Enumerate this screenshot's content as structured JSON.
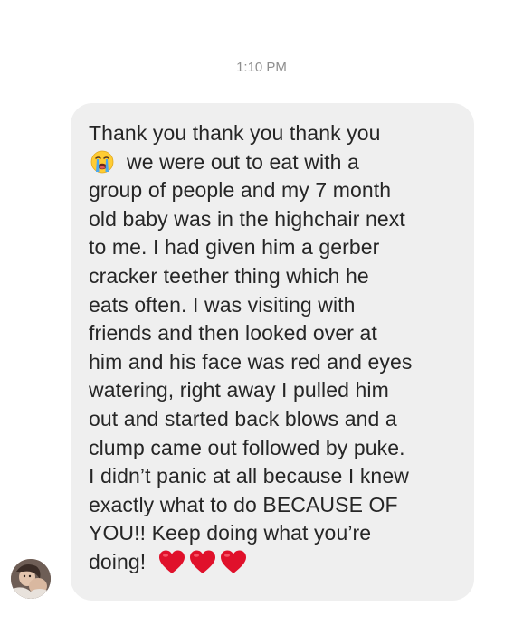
{
  "timestamp": "1:10 PM",
  "message": {
    "line1": "Thank you thank you thank you",
    "line2_emoji": "loudly-crying-face-emoji",
    "line2": "we were out to eat with a",
    "line3": "group of people and my 7 month",
    "line4": "old baby was in the highchair next",
    "line5": "to me. I had given him a gerber",
    "line6": "cracker teether thing which he",
    "line7": "eats often. I was visiting with",
    "line8": "friends and then looked over at",
    "line9": "him and his face was red and eyes",
    "line10": "watering, right away I pulled him",
    "line11": "out and started back blows and a",
    "line12": "clump came out followed by puke.",
    "line13": "I didn’t panic at all because I knew",
    "line14": "exactly what to do BECAUSE OF",
    "line15": "YOU!! Keep doing what you’re",
    "line16": "doing!",
    "trailing_emojis": [
      "red-heart-emoji",
      "red-heart-emoji",
      "red-heart-emoji"
    ]
  },
  "colors": {
    "bubble_background": "#efefef",
    "text": "#262626",
    "timestamp": "#8e8e8e",
    "heart": "#e0112b",
    "emoji_face": "#ffcc33"
  }
}
